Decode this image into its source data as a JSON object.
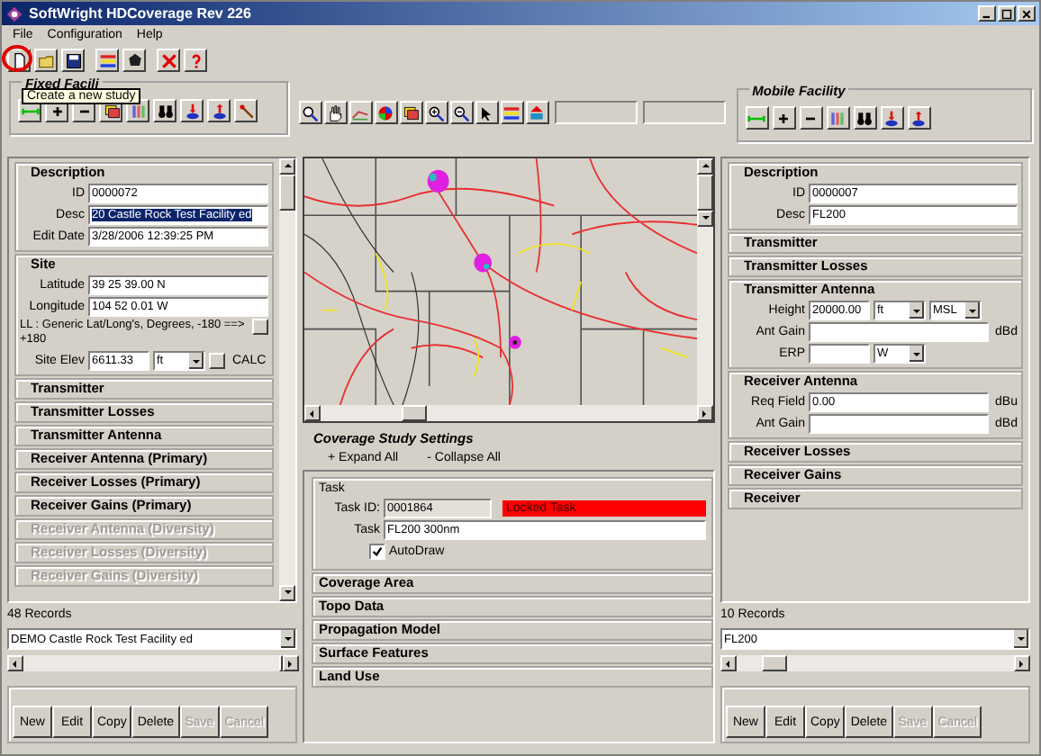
{
  "window": {
    "title": "SoftWright HDCoverage Rev 226"
  },
  "menu": [
    {
      "label": "File"
    },
    {
      "label": "Configuration"
    },
    {
      "label": "Help"
    }
  ],
  "toolbar": {
    "tooltip": "Create a new study",
    "highlight_ring": true
  },
  "fixed_facility": {
    "title": "Fixed Facili",
    "sections": [
      {
        "title": "Description",
        "expanded": true,
        "disabled": false,
        "fields": [
          {
            "kind": "input",
            "label": "ID",
            "value": "0000072"
          },
          {
            "kind": "input",
            "label": "Desc",
            "value": "20 Castle Rock Test Facility ed",
            "highlighted": true
          },
          {
            "kind": "input",
            "label": "Edit Date",
            "value": "3/28/2006 12:39:25 PM"
          }
        ]
      },
      {
        "title": "Site",
        "expanded": true,
        "disabled": false,
        "fields": [
          {
            "kind": "input",
            "label": "Latitude",
            "value": "39 25 39.00 N"
          },
          {
            "kind": "input",
            "label": "Longitude",
            "value": "104 52 0.01 W"
          },
          {
            "kind": "note",
            "text": "LL : Generic Lat/Long's, Degrees, -180 ==> +180"
          },
          {
            "kind": "input",
            "label": "Site Elev",
            "value": "6611.33",
            "units": [
              "ft"
            ],
            "calc_label": "CALC"
          }
        ]
      },
      {
        "title": "Transmitter",
        "expanded": false,
        "disabled": false
      },
      {
        "title": "Transmitter Losses",
        "expanded": false,
        "disabled": false
      },
      {
        "title": "Transmitter Antenna",
        "expanded": false,
        "disabled": false
      },
      {
        "title": "Receiver Antenna (Primary)",
        "expanded": false,
        "disabled": false
      },
      {
        "title": "Receiver Losses (Primary)",
        "expanded": false,
        "disabled": false
      },
      {
        "title": "Receiver Gains (Primary)",
        "expanded": false,
        "disabled": false
      },
      {
        "title": "Receiver Antenna (Diversity)",
        "expanded": false,
        "disabled": true
      },
      {
        "title": "Receiver Losses (Diversity)",
        "expanded": false,
        "disabled": true
      },
      {
        "title": "Receiver Gains (Diversity)",
        "expanded": false,
        "disabled": true
      }
    ],
    "records": "48 Records",
    "record": "DEMO Castle Rock Test Facility ed",
    "buttons": [
      {
        "label": "New",
        "disabled": false
      },
      {
        "label": "Edit",
        "disabled": false
      },
      {
        "label": "Copy",
        "disabled": false
      },
      {
        "label": "Delete",
        "disabled": false
      },
      {
        "label": "Save",
        "disabled": true
      },
      {
        "label": "Cancel",
        "disabled": true
      }
    ]
  },
  "study_settings": {
    "title": "Coverage Study Settings",
    "expand_all": "+ Expand All",
    "collapse_all": "- Collapse All",
    "task": {
      "title": "Task",
      "id_label": "Task ID:",
      "id": "0001864",
      "status": "Locked Task",
      "locked": true,
      "task_label": "Task",
      "task": "FL200 300nm",
      "autodraw": {
        "label": "AutoDraw",
        "checked": true
      }
    },
    "sections": [
      {
        "title": "Coverage Area"
      },
      {
        "title": "Topo Data"
      },
      {
        "title": "Propagation Model"
      },
      {
        "title": "Surface Features"
      },
      {
        "title": "Land Use"
      }
    ]
  },
  "mobile_facility": {
    "title": "Mobile Facility",
    "sections": [
      {
        "title": "Description",
        "expanded": true,
        "disabled": false,
        "fields": [
          {
            "kind": "input",
            "label": "ID",
            "value": "0000007"
          },
          {
            "kind": "input",
            "label": "Desc",
            "value": "FL200"
          }
        ]
      },
      {
        "title": "Transmitter",
        "expanded": false,
        "disabled": false
      },
      {
        "title": "Transmitter Losses",
        "expanded": false,
        "disabled": false
      },
      {
        "title": "Transmitter Antenna",
        "expanded": true,
        "disabled": false,
        "fields": [
          {
            "kind": "input",
            "label": "Height",
            "value": "20000.00",
            "units": [
              "ft",
              "MSL"
            ]
          },
          {
            "kind": "input",
            "label": "Ant Gain",
            "suffix": "dBd"
          },
          {
            "kind": "input",
            "label": "ERP",
            "units": [
              "W"
            ]
          }
        ]
      },
      {
        "title": "Receiver Antenna",
        "expanded": true,
        "disabled": false,
        "fields": [
          {
            "kind": "input",
            "label": "Req Field",
            "value": "0.00",
            "suffix": "dBu"
          },
          {
            "kind": "input",
            "label": "Ant Gain",
            "suffix": "dBd"
          }
        ]
      },
      {
        "title": "Receiver Losses",
        "expanded": false,
        "disabled": false
      },
      {
        "title": "Receiver Gains",
        "expanded": false,
        "disabled": false
      },
      {
        "title": "Receiver",
        "expanded": false,
        "disabled": false
      }
    ],
    "records": "10 Records",
    "record": "FL200",
    "buttons": [
      {
        "label": "New",
        "disabled": false
      },
      {
        "label": "Edit",
        "disabled": false
      },
      {
        "label": "Copy",
        "disabled": false
      },
      {
        "label": "Delete",
        "disabled": false
      },
      {
        "label": "Save",
        "disabled": true
      },
      {
        "label": "Cancel",
        "disabled": true
      }
    ]
  }
}
